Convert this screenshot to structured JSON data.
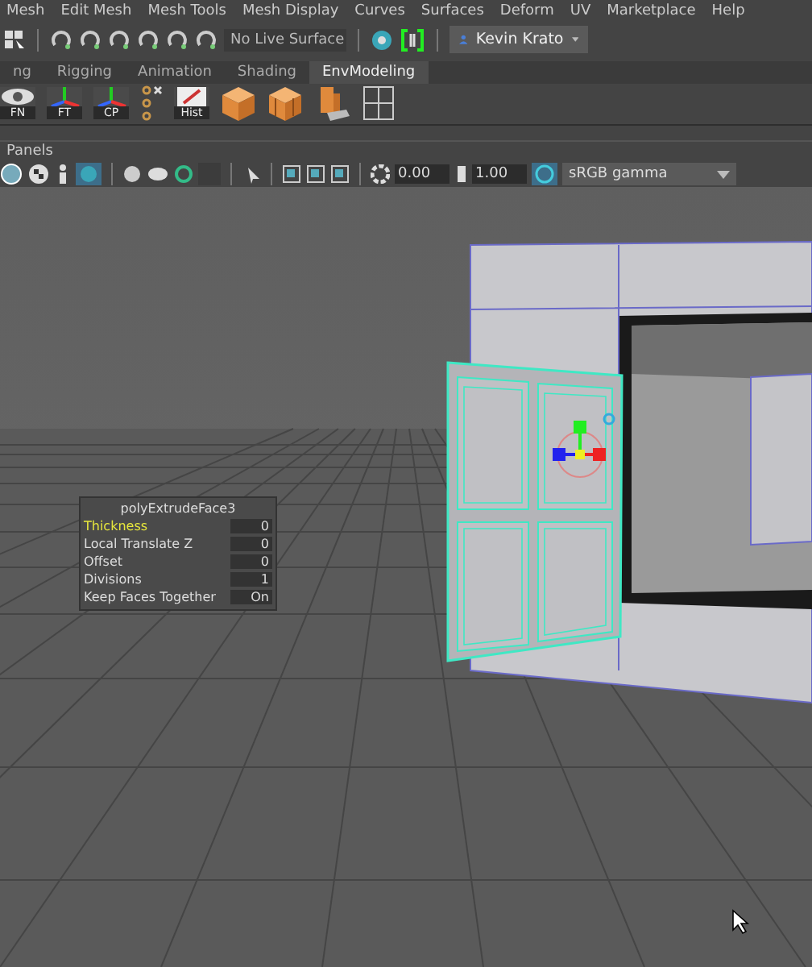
{
  "menu": [
    "Mesh",
    "Edit Mesh",
    "Mesh Tools",
    "Mesh Display",
    "Curves",
    "Surfaces",
    "Deform",
    "UV",
    "Marketplace",
    "Help"
  ],
  "status_line": {
    "live_surface": "No Live Surface",
    "user": "Kevin Krato"
  },
  "shelf_tabs": [
    {
      "label": "ng",
      "selected": false
    },
    {
      "label": "Rigging",
      "selected": false
    },
    {
      "label": "Animation",
      "selected": false
    },
    {
      "label": "Shading",
      "selected": false
    },
    {
      "label": "EnvModeling",
      "selected": true
    }
  ],
  "shelf_buttons": [
    {
      "kind": "eye",
      "label": "FN"
    },
    {
      "kind": "axis",
      "label": "FT"
    },
    {
      "kind": "axis",
      "label": "CP"
    },
    {
      "kind": "chain"
    },
    {
      "kind": "note",
      "label": "Hist"
    },
    {
      "kind": "cube"
    },
    {
      "kind": "crate"
    },
    {
      "kind": "stack"
    },
    {
      "kind": "grid"
    }
  ],
  "panel_menu": "Panels",
  "panel_toolbar": {
    "exposure": "0.00",
    "gamma": "1.00",
    "color_space": "sRGB gamma"
  },
  "node_editor": {
    "title": "polyExtrudeFace3",
    "rows": [
      {
        "label": "Thickness",
        "value": "0",
        "selected": true
      },
      {
        "label": "Local Translate Z",
        "value": "0",
        "selected": false
      },
      {
        "label": "Offset",
        "value": "0",
        "selected": false
      },
      {
        "label": "Divisions",
        "value": "1",
        "selected": false
      },
      {
        "label": "Keep Faces Together",
        "value": "On",
        "selected": false
      }
    ]
  }
}
